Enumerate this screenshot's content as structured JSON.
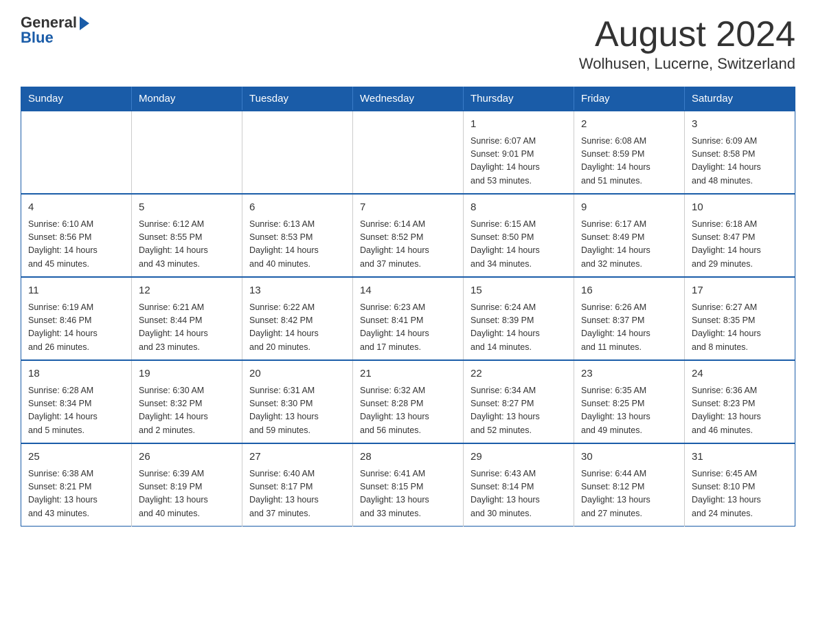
{
  "logo": {
    "general": "General",
    "blue": "Blue"
  },
  "title": "August 2024",
  "location": "Wolhusen, Lucerne, Switzerland",
  "weekdays": [
    "Sunday",
    "Monday",
    "Tuesday",
    "Wednesday",
    "Thursday",
    "Friday",
    "Saturday"
  ],
  "weeks": [
    [
      {
        "day": "",
        "info": ""
      },
      {
        "day": "",
        "info": ""
      },
      {
        "day": "",
        "info": ""
      },
      {
        "day": "",
        "info": ""
      },
      {
        "day": "1",
        "info": "Sunrise: 6:07 AM\nSunset: 9:01 PM\nDaylight: 14 hours\nand 53 minutes."
      },
      {
        "day": "2",
        "info": "Sunrise: 6:08 AM\nSunset: 8:59 PM\nDaylight: 14 hours\nand 51 minutes."
      },
      {
        "day": "3",
        "info": "Sunrise: 6:09 AM\nSunset: 8:58 PM\nDaylight: 14 hours\nand 48 minutes."
      }
    ],
    [
      {
        "day": "4",
        "info": "Sunrise: 6:10 AM\nSunset: 8:56 PM\nDaylight: 14 hours\nand 45 minutes."
      },
      {
        "day": "5",
        "info": "Sunrise: 6:12 AM\nSunset: 8:55 PM\nDaylight: 14 hours\nand 43 minutes."
      },
      {
        "day": "6",
        "info": "Sunrise: 6:13 AM\nSunset: 8:53 PM\nDaylight: 14 hours\nand 40 minutes."
      },
      {
        "day": "7",
        "info": "Sunrise: 6:14 AM\nSunset: 8:52 PM\nDaylight: 14 hours\nand 37 minutes."
      },
      {
        "day": "8",
        "info": "Sunrise: 6:15 AM\nSunset: 8:50 PM\nDaylight: 14 hours\nand 34 minutes."
      },
      {
        "day": "9",
        "info": "Sunrise: 6:17 AM\nSunset: 8:49 PM\nDaylight: 14 hours\nand 32 minutes."
      },
      {
        "day": "10",
        "info": "Sunrise: 6:18 AM\nSunset: 8:47 PM\nDaylight: 14 hours\nand 29 minutes."
      }
    ],
    [
      {
        "day": "11",
        "info": "Sunrise: 6:19 AM\nSunset: 8:46 PM\nDaylight: 14 hours\nand 26 minutes."
      },
      {
        "day": "12",
        "info": "Sunrise: 6:21 AM\nSunset: 8:44 PM\nDaylight: 14 hours\nand 23 minutes."
      },
      {
        "day": "13",
        "info": "Sunrise: 6:22 AM\nSunset: 8:42 PM\nDaylight: 14 hours\nand 20 minutes."
      },
      {
        "day": "14",
        "info": "Sunrise: 6:23 AM\nSunset: 8:41 PM\nDaylight: 14 hours\nand 17 minutes."
      },
      {
        "day": "15",
        "info": "Sunrise: 6:24 AM\nSunset: 8:39 PM\nDaylight: 14 hours\nand 14 minutes."
      },
      {
        "day": "16",
        "info": "Sunrise: 6:26 AM\nSunset: 8:37 PM\nDaylight: 14 hours\nand 11 minutes."
      },
      {
        "day": "17",
        "info": "Sunrise: 6:27 AM\nSunset: 8:35 PM\nDaylight: 14 hours\nand 8 minutes."
      }
    ],
    [
      {
        "day": "18",
        "info": "Sunrise: 6:28 AM\nSunset: 8:34 PM\nDaylight: 14 hours\nand 5 minutes."
      },
      {
        "day": "19",
        "info": "Sunrise: 6:30 AM\nSunset: 8:32 PM\nDaylight: 14 hours\nand 2 minutes."
      },
      {
        "day": "20",
        "info": "Sunrise: 6:31 AM\nSunset: 8:30 PM\nDaylight: 13 hours\nand 59 minutes."
      },
      {
        "day": "21",
        "info": "Sunrise: 6:32 AM\nSunset: 8:28 PM\nDaylight: 13 hours\nand 56 minutes."
      },
      {
        "day": "22",
        "info": "Sunrise: 6:34 AM\nSunset: 8:27 PM\nDaylight: 13 hours\nand 52 minutes."
      },
      {
        "day": "23",
        "info": "Sunrise: 6:35 AM\nSunset: 8:25 PM\nDaylight: 13 hours\nand 49 minutes."
      },
      {
        "day": "24",
        "info": "Sunrise: 6:36 AM\nSunset: 8:23 PM\nDaylight: 13 hours\nand 46 minutes."
      }
    ],
    [
      {
        "day": "25",
        "info": "Sunrise: 6:38 AM\nSunset: 8:21 PM\nDaylight: 13 hours\nand 43 minutes."
      },
      {
        "day": "26",
        "info": "Sunrise: 6:39 AM\nSunset: 8:19 PM\nDaylight: 13 hours\nand 40 minutes."
      },
      {
        "day": "27",
        "info": "Sunrise: 6:40 AM\nSunset: 8:17 PM\nDaylight: 13 hours\nand 37 minutes."
      },
      {
        "day": "28",
        "info": "Sunrise: 6:41 AM\nSunset: 8:15 PM\nDaylight: 13 hours\nand 33 minutes."
      },
      {
        "day": "29",
        "info": "Sunrise: 6:43 AM\nSunset: 8:14 PM\nDaylight: 13 hours\nand 30 minutes."
      },
      {
        "day": "30",
        "info": "Sunrise: 6:44 AM\nSunset: 8:12 PM\nDaylight: 13 hours\nand 27 minutes."
      },
      {
        "day": "31",
        "info": "Sunrise: 6:45 AM\nSunset: 8:10 PM\nDaylight: 13 hours\nand 24 minutes."
      }
    ]
  ]
}
